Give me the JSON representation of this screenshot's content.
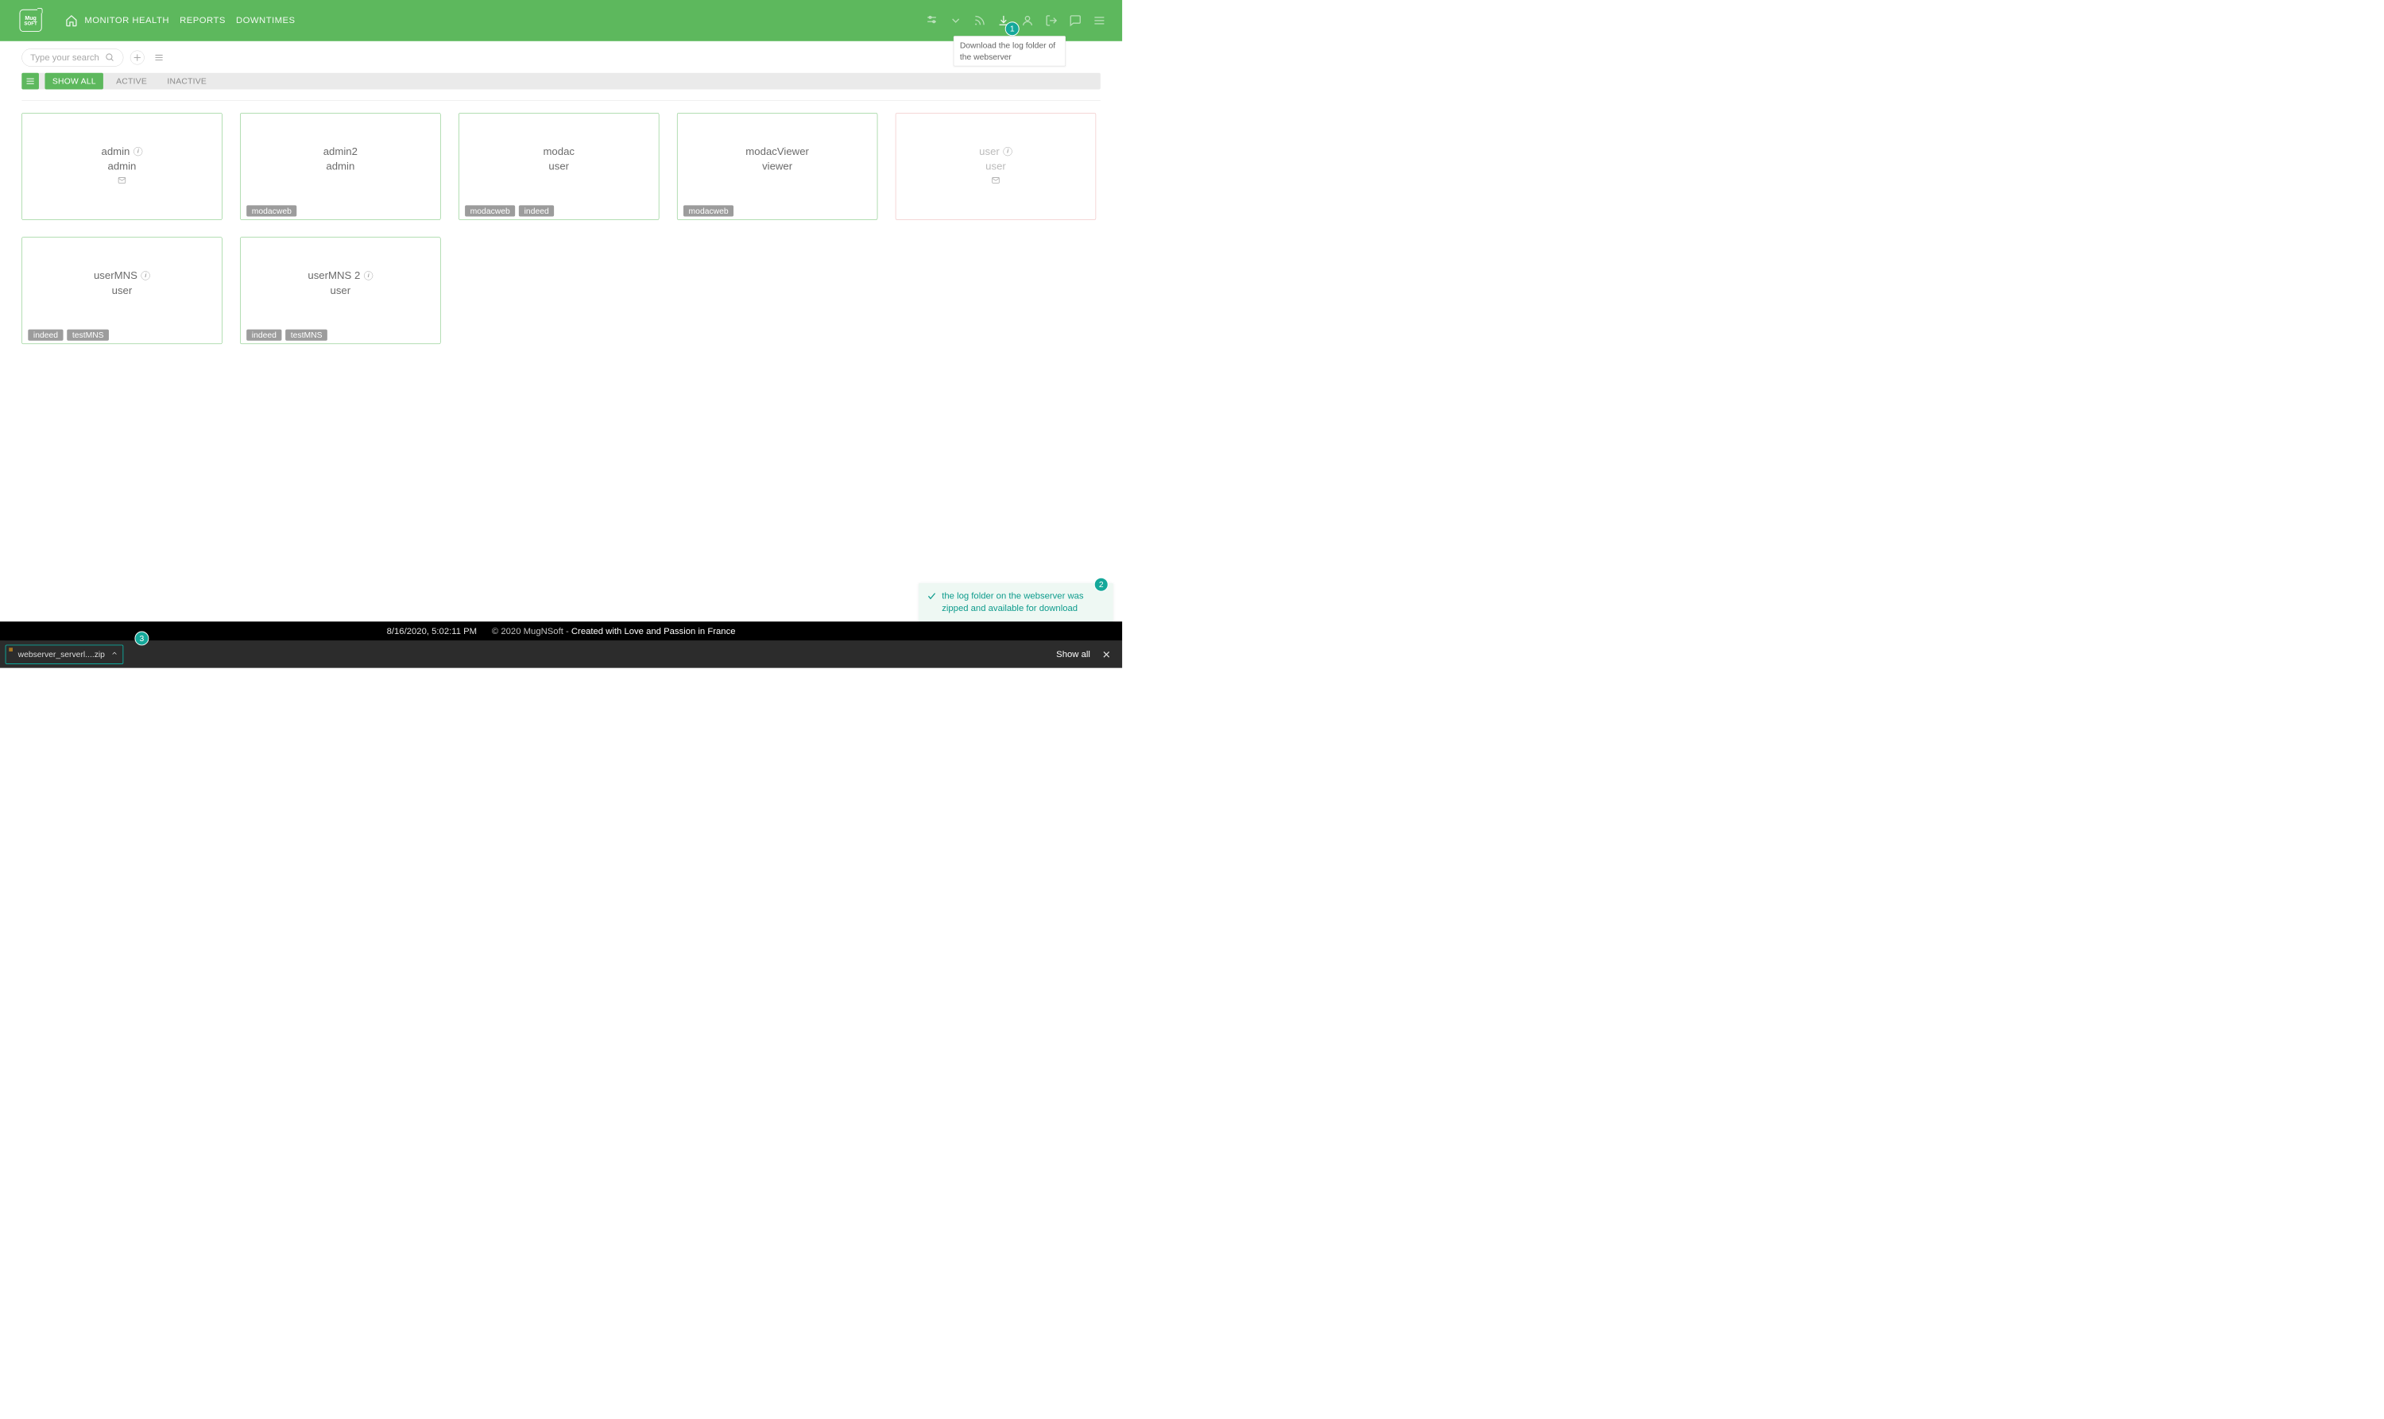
{
  "brand": "MugNSoft",
  "nav": {
    "monitor_health": "MONITOR HEALTH",
    "reports": "REPORTS",
    "downtimes": "DOWNTIMES"
  },
  "tooltip_download": "Download the log folder of the webserver",
  "search": {
    "placeholder": "Type your search"
  },
  "filters": {
    "show_all": "SHOW ALL",
    "active": "ACTIVE",
    "inactive": "INACTIVE"
  },
  "cards": [
    {
      "name": "admin",
      "role": "admin",
      "info": true,
      "mail": true,
      "tags": []
    },
    {
      "name": "admin2",
      "role": "admin",
      "info": false,
      "mail": false,
      "tags": [
        "modacweb"
      ]
    },
    {
      "name": "modac",
      "role": "user",
      "info": false,
      "mail": false,
      "tags": [
        "modacweb",
        "indeed"
      ]
    },
    {
      "name": "modacViewer",
      "role": "viewer",
      "info": false,
      "mail": false,
      "tags": [
        "modacweb"
      ]
    },
    {
      "name": "user",
      "role": "user",
      "info": true,
      "mail": true,
      "tags": [],
      "red": true
    },
    {
      "name": "userMNS",
      "role": "user",
      "info": true,
      "mail": false,
      "tags": [
        "indeed",
        "testMNS"
      ]
    },
    {
      "name": "userMNS 2",
      "role": "user",
      "info": true,
      "mail": false,
      "tags": [
        "indeed",
        "testMNS"
      ]
    }
  ],
  "toast": "the log folder on the webserver was zipped and available for download",
  "badges": {
    "b1": "1",
    "b2": "2",
    "b3": "3"
  },
  "footer": {
    "timestamp": "8/16/2020, 5:02:11 PM",
    "copyright": "© 2020 MugNSoft - ",
    "credit": "Created with Love and Passion in France"
  },
  "download_bar": {
    "filename": "webserver_serverl....zip",
    "show_all": "Show all"
  }
}
